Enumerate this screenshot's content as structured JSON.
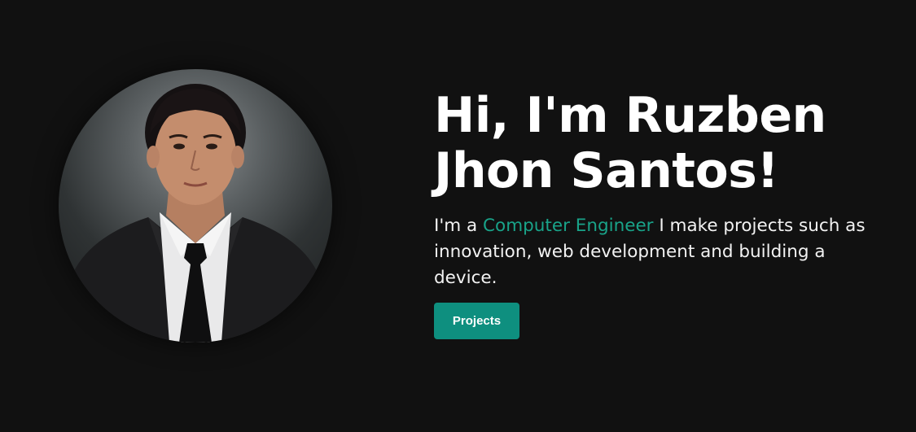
{
  "hero": {
    "title": "Hi, I'm Ruzben Jhon Santos!",
    "desc_prefix": "I'm a ",
    "desc_highlight": "Computer Engineer",
    "desc_suffix": " I make projects such as innovation, web development and building a device.",
    "button_label": "Projects"
  },
  "colors": {
    "background": "#111111",
    "accent": "#19a389",
    "button": "#0e8f7f"
  },
  "icons": {
    "avatar": "profile-photo"
  }
}
